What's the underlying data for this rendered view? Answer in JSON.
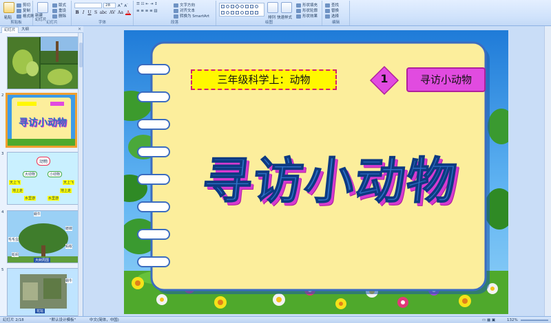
{
  "ribbon": {
    "clipboard": {
      "paste": "粘贴",
      "cut": "剪切",
      "copy": "复制",
      "format_painter": "格式刷",
      "label": "剪贴板"
    },
    "slides": {
      "new_slide": "新建\n幻灯片",
      "layout": "版式",
      "reset": "重设",
      "delete": "删除",
      "label": "幻灯片"
    },
    "font": {
      "size": "28",
      "label": "字体",
      "buttons": [
        "B",
        "I",
        "U",
        "S",
        "abc",
        "AV",
        "Aa",
        "A"
      ]
    },
    "paragraph": {
      "text_direction": "文字方向",
      "align_text": "对齐文本",
      "smartart": "转换为 SmartArt",
      "label": "段落"
    },
    "drawing": {
      "arrange": "排列",
      "quick_styles": "快速样式",
      "shape_fill": "形状填充",
      "shape_outline": "形状轮廓",
      "shape_effects": "形状效果",
      "label": "绘图"
    },
    "editing": {
      "find": "查找",
      "replace": "替换",
      "select": "选择",
      "label": "编辑"
    }
  },
  "panel": {
    "tabs": [
      "幻灯片",
      "大纲"
    ],
    "thumbs": [
      {
        "num": "",
        "kind": "photo"
      },
      {
        "num": "2",
        "kind": "title",
        "title": "寻访小动物"
      },
      {
        "num": "3",
        "kind": "diagram",
        "center": "动物",
        "nodes": [
          "大动物",
          "小动物",
          "天上飞",
          "地上走",
          "水里游",
          "天上飞",
          "地上走",
          "水里游"
        ]
      },
      {
        "num": "4",
        "kind": "tree",
        "labels": [
          "蜗牛",
          "毛毛虫",
          "蟋蟀",
          "蚂蚁",
          "瓢虫",
          "蜘蛛",
          "蚯蚓",
          "大树周围"
        ]
      },
      {
        "num": "5",
        "kind": "garden",
        "labels": [
          "蝴蝶",
          "蜗牛",
          "蚯蚓",
          "花坛",
          "蚂蚁"
        ]
      }
    ]
  },
  "slide": {
    "subtitle": "三年级科学上：动物",
    "number": "1",
    "lesson": "寻访小动物",
    "title": "寻访小动物"
  },
  "status": {
    "slide_info": "幻灯片 2/18",
    "theme": "\"默认设计模板\"",
    "language": "中文(简体，中国)",
    "zoom": "132%"
  },
  "colors": {
    "notebook": "#fcee9c",
    "title_fill": "#2e6fc4",
    "title_shadow": "#d63ad0",
    "badge": "#e14be0",
    "subtitle_bg": "#fff800",
    "accent_border": "#d41f6b"
  }
}
